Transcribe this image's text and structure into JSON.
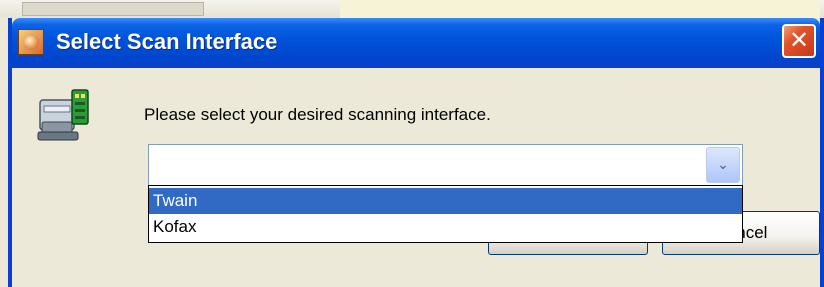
{
  "window": {
    "title": "Select Scan Interface",
    "close_glyph": "✕"
  },
  "dialog": {
    "prompt": "Please select your desired scanning interface.",
    "scanner_icon": "scanner-icon"
  },
  "combo": {
    "value": "",
    "arrow_glyph": "⌄",
    "options": [
      "Twain",
      "Kofax"
    ],
    "highlighted": "Twain"
  },
  "buttons": {
    "ok_label": "",
    "cancel_label": "Cancel"
  },
  "colors": {
    "titlebar": "#0052da",
    "selection": "#316ac5",
    "close": "#e0542a"
  }
}
